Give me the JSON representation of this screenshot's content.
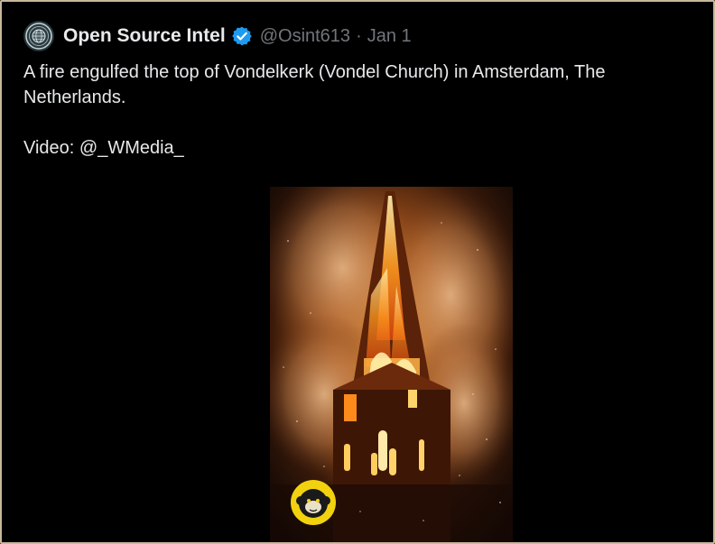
{
  "tweet": {
    "author": {
      "display_name": "Open Source Intel",
      "handle": "@Osint613",
      "verified": true,
      "verified_icon": "verified-badge-icon",
      "avatar_icon": "globe-seal-icon"
    },
    "separator": "·",
    "date": "Jan 1",
    "text_paragraphs": [
      "A fire engulfed the top of Vondelkerk (Vondel Church) in Amsterdam, The Netherlands.",
      "Video: @_WMedia_"
    ],
    "media": {
      "type": "video",
      "watermark_icon": "monkey-logo-icon"
    }
  },
  "colors": {
    "background": "#000000",
    "text_primary": "#e7e9ea",
    "text_secondary": "#71767b",
    "verified_blue": "#1d9bf0",
    "frame_border": "#c9b79a"
  }
}
